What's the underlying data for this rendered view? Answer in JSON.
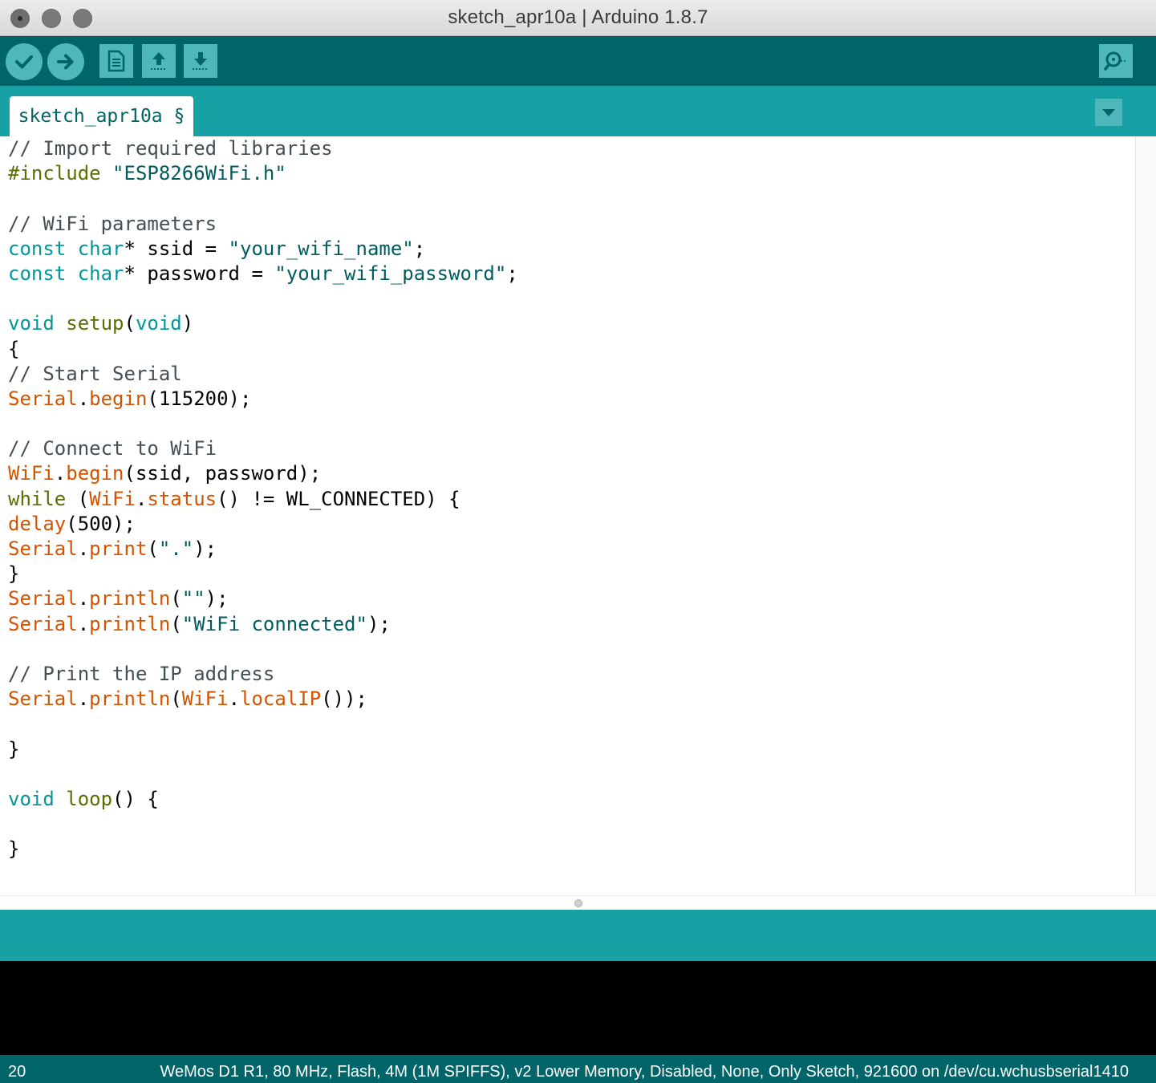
{
  "window": {
    "title": "sketch_apr10a | Arduino 1.8.7"
  },
  "toolbar": {
    "verify": "verify-icon",
    "upload": "upload-arrow-icon",
    "new": "new-file-icon",
    "open": "open-icon",
    "save": "save-icon",
    "serial_monitor": "serial-monitor-icon",
    "accent": "#006468",
    "button_color": "#4db7bb"
  },
  "tabs": [
    {
      "label": "sketch_apr10a §"
    }
  ],
  "editor": {
    "lines": [
      [
        {
          "t": "// Import required libraries",
          "c": "com"
        }
      ],
      [
        {
          "t": "#include",
          "c": "pre"
        },
        {
          "t": " ",
          "c": ""
        },
        {
          "t": "\"ESP8266WiFi.h\"",
          "c": "str"
        }
      ],
      [],
      [
        {
          "t": "// WiFi parameters",
          "c": "com"
        }
      ],
      [
        {
          "t": "const",
          "c": "kw"
        },
        {
          "t": " ",
          "c": ""
        },
        {
          "t": "char",
          "c": "kw"
        },
        {
          "t": "* ssid = ",
          "c": ""
        },
        {
          "t": "\"your_wifi_name\"",
          "c": "str"
        },
        {
          "t": ";",
          "c": ""
        }
      ],
      [
        {
          "t": "const",
          "c": "kw"
        },
        {
          "t": " ",
          "c": ""
        },
        {
          "t": "char",
          "c": "kw"
        },
        {
          "t": "* password = ",
          "c": ""
        },
        {
          "t": "\"your_wifi_password\"",
          "c": "str"
        },
        {
          "t": ";",
          "c": ""
        }
      ],
      [],
      [
        {
          "t": "void",
          "c": "kw"
        },
        {
          "t": " ",
          "c": ""
        },
        {
          "t": "setup",
          "c": "ctl"
        },
        {
          "t": "(",
          "c": ""
        },
        {
          "t": "void",
          "c": "kw"
        },
        {
          "t": ")",
          "c": ""
        }
      ],
      [
        {
          "t": "{",
          "c": ""
        }
      ],
      [
        {
          "t": "// Start Serial",
          "c": "com"
        }
      ],
      [
        {
          "t": "Serial",
          "c": "fn"
        },
        {
          "t": ".",
          "c": ""
        },
        {
          "t": "begin",
          "c": "fn"
        },
        {
          "t": "(115200);",
          "c": ""
        }
      ],
      [],
      [
        {
          "t": "// Connect to WiFi",
          "c": "com"
        }
      ],
      [
        {
          "t": "WiFi",
          "c": "fn"
        },
        {
          "t": ".",
          "c": ""
        },
        {
          "t": "begin",
          "c": "fn"
        },
        {
          "t": "(ssid, password);",
          "c": ""
        }
      ],
      [
        {
          "t": "while",
          "c": "ctl"
        },
        {
          "t": " (",
          "c": ""
        },
        {
          "t": "WiFi",
          "c": "fn"
        },
        {
          "t": ".",
          "c": ""
        },
        {
          "t": "status",
          "c": "fn"
        },
        {
          "t": "() != WL_CONNECTED) {",
          "c": ""
        }
      ],
      [
        {
          "t": "delay",
          "c": "fn"
        },
        {
          "t": "(500);",
          "c": ""
        }
      ],
      [
        {
          "t": "Serial",
          "c": "fn"
        },
        {
          "t": ".",
          "c": ""
        },
        {
          "t": "print",
          "c": "fn"
        },
        {
          "t": "(",
          "c": ""
        },
        {
          "t": "\".\"",
          "c": "str"
        },
        {
          "t": ");",
          "c": ""
        }
      ],
      [
        {
          "t": "}",
          "c": ""
        }
      ],
      [
        {
          "t": "Serial",
          "c": "fn"
        },
        {
          "t": ".",
          "c": ""
        },
        {
          "t": "println",
          "c": "fn"
        },
        {
          "t": "(",
          "c": ""
        },
        {
          "t": "\"\"",
          "c": "str"
        },
        {
          "t": ");",
          "c": ""
        }
      ],
      [
        {
          "t": "Serial",
          "c": "fn"
        },
        {
          "t": ".",
          "c": ""
        },
        {
          "t": "println",
          "c": "fn"
        },
        {
          "t": "(",
          "c": ""
        },
        {
          "t": "\"WiFi connected\"",
          "c": "str"
        },
        {
          "t": ");",
          "c": ""
        }
      ],
      [],
      [
        {
          "t": "// Print the IP address",
          "c": "com"
        }
      ],
      [
        {
          "t": "Serial",
          "c": "fn"
        },
        {
          "t": ".",
          "c": ""
        },
        {
          "t": "println",
          "c": "fn"
        },
        {
          "t": "(",
          "c": ""
        },
        {
          "t": "WiFi",
          "c": "fn"
        },
        {
          "t": ".",
          "c": ""
        },
        {
          "t": "localIP",
          "c": "fn"
        },
        {
          "t": "());",
          "c": ""
        }
      ],
      [],
      [
        {
          "t": "}",
          "c": ""
        }
      ],
      [],
      [
        {
          "t": "void",
          "c": "kw"
        },
        {
          "t": " ",
          "c": ""
        },
        {
          "t": "loop",
          "c": "ctl"
        },
        {
          "t": "() {",
          "c": ""
        }
      ],
      [],
      [
        {
          "t": "}",
          "c": ""
        }
      ]
    ]
  },
  "status": {
    "line_number": "20",
    "board_info": "WeMos D1 R1, 80 MHz, Flash, 4M (1M SPIFFS), v2 Lower Memory, Disabled, None, Only Sketch, 921600 on /dev/cu.wchusbserial1410"
  }
}
